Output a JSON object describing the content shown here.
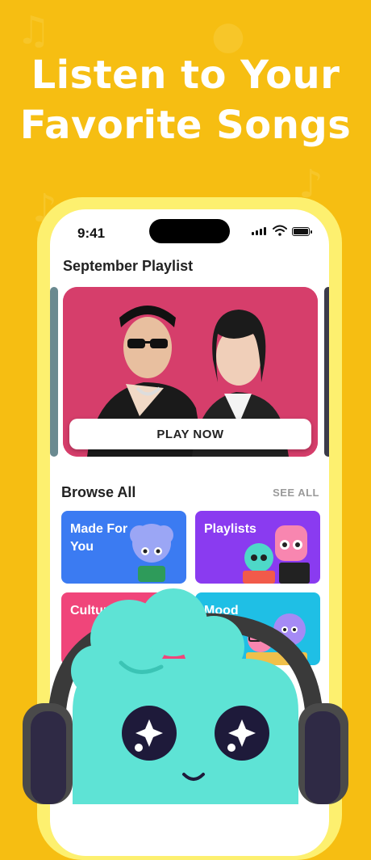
{
  "headline": {
    "line1": "Listen to Your",
    "line2": "Favorite Songs"
  },
  "status_bar": {
    "time": "9:41"
  },
  "featured": {
    "title": "September Playlist",
    "play_label": "PLAY NOW"
  },
  "browse": {
    "title": "Browse All",
    "see_all": "SEE ALL",
    "tiles": [
      {
        "label": "Made For You",
        "color": "#3B7BF2"
      },
      {
        "label": "Playlists",
        "color": "#8A3BF0"
      },
      {
        "label": "Culture",
        "color": "#F0457A"
      },
      {
        "label": "Mood",
        "color": "#1FBFE5"
      }
    ]
  },
  "colors": {
    "background": "#F6BE12",
    "phone_frame": "#FDF06F",
    "mascot": "#5EE3D5"
  }
}
